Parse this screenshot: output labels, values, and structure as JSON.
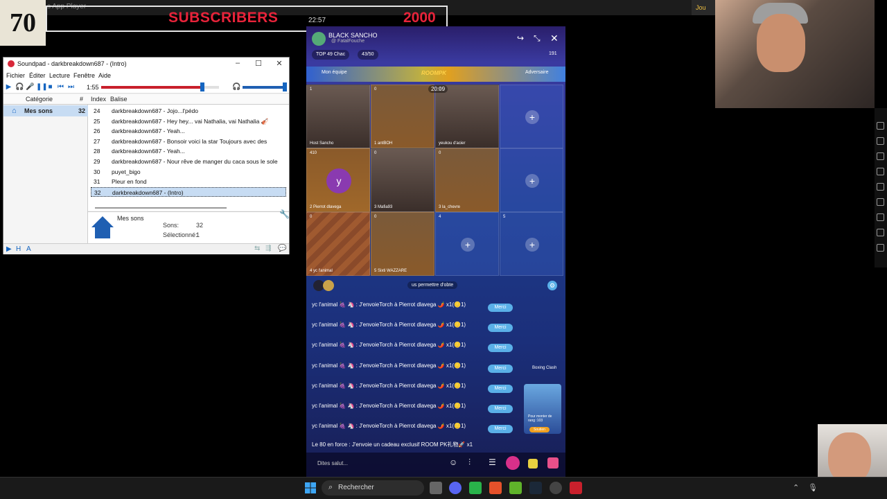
{
  "overlay": {
    "subscriber_count": "70",
    "subscriber_label": "SUBSCRIBERS",
    "subscriber_goal": "2000",
    "clock": "22:57",
    "bluestacks_title": "s App Player",
    "right_top": "Jou"
  },
  "soundpad": {
    "title": "Soundpad - darkbreakdown687 - (Intro)",
    "menu": [
      "Fichier",
      "Éditer",
      "Lecture",
      "Fenêtre",
      "Aide"
    ],
    "time": "1:55",
    "progress": 0.86,
    "volume": 0.95,
    "category_header": "Catégorie",
    "count_header": "#",
    "category": {
      "name": "Mes sons",
      "count": "32"
    },
    "list_header": {
      "index": "Index",
      "tag": "Balise"
    },
    "rows": [
      {
        "index": "24",
        "name": "darkbreakdown687 - Jojo...l'pédo"
      },
      {
        "index": "25",
        "name": "darkbreakdown687 - Hey hey... vai Nathalia, vai Nathalia 🎻"
      },
      {
        "index": "26",
        "name": "darkbreakdown687 - Yeah..."
      },
      {
        "index": "27",
        "name": "darkbreakdown687 - Bonsoir voici la star Toujours avec des"
      },
      {
        "index": "28",
        "name": "darkbreakdown687 - Yeah..."
      },
      {
        "index": "29",
        "name": "darkbreakdown687 - Nour rêve de manger du caca sous le sole"
      },
      {
        "index": "30",
        "name": "puyet_bigo"
      },
      {
        "index": "31",
        "name": "Pleur en fond"
      },
      {
        "index": "32",
        "name": "darkbreakdown687 - (Intro)"
      }
    ],
    "info": {
      "name": "Mes sons",
      "sons_label": "Sons:",
      "sons_value": "32",
      "selected_label": "Sélectionné:",
      "selected_value": "1"
    }
  },
  "phone": {
    "host_name": "BLACK SANCHO",
    "host_sub": "@ FatalFouche",
    "top_badge": "TOP 49 Chac",
    "coins": "43/50",
    "viewers": "191",
    "team_left": "Mon équipe",
    "team_right": "Adversaire",
    "roompk": "ROOMPK",
    "timer": "20:09",
    "cells": [
      {
        "num": "1",
        "name": "Host  Sancho",
        "type": "video"
      },
      {
        "num": "0",
        "name": "1  antBOH",
        "type": "avatar"
      },
      {
        "num": "0",
        "name": "yeukou d'acier",
        "type": "video"
      },
      {
        "num": "",
        "name": "",
        "type": "empty"
      },
      {
        "num": "410",
        "name": "2  Pierrot dlavega",
        "type": "avatar-y"
      },
      {
        "num": "0",
        "name": "3  Mafia93",
        "type": "video"
      },
      {
        "num": "0",
        "name": "3  la_chevre",
        "type": "avatar"
      },
      {
        "num": "",
        "name": "",
        "type": "empty"
      },
      {
        "num": "0",
        "name": "4  yc l'animal",
        "type": "striped"
      },
      {
        "num": "0",
        "name": "5  Sixti WAZZARE",
        "type": "avatar"
      },
      {
        "num": "4",
        "name": "",
        "type": "empty"
      },
      {
        "num": "5",
        "name": "",
        "type": "empty"
      }
    ],
    "notice": "us permettre d'obte",
    "chat": [
      {
        "text": "yc l'animal 🍇 🦄 : J'envoieTorch à Pierrot dlavega 🌶️ x1(🪙1)",
        "button": "Merci"
      },
      {
        "text": "yc l'animal 🍇 🦄 : J'envoieTorch à Pierrot dlavega 🌶️ x1(🪙1)",
        "button": "Merci"
      },
      {
        "text": "yc l'animal 🍇 🦄 : J'envoieTorch à Pierrot dlavega 🌶️ x1(🪙1)",
        "button": "Merci"
      },
      {
        "text": "yc l'animal 🍇 🦄 : J'envoieTorch à Pierrot dlavega 🌶️ x1(🪙1)",
        "button": "Merci"
      },
      {
        "text": "yc l'animal 🍇 🦄 : J'envoieTorch à Pierrot dlavega 🌶️ x1(🪙1)",
        "button": "Merci"
      },
      {
        "text": "yc l'animal 🍇 🦄 : J'envoieTorch à Pierrot dlavega 🌶️ x1(🪙1)",
        "button": "Merci"
      },
      {
        "text": "yc l'animal 🍇 🦄 : J'envoieTorch à Pierrot dlavega 🌶️ x1(🪙1)",
        "button": "Merci"
      }
    ],
    "last_line": "Le 80 en force : J'envoie un cadeau exclusif ROOM PK礼物🚀 x1",
    "input_placeholder": "Dites salut...",
    "boxing": "Boxing Clash",
    "promo_text": "Pour monter de rang :103",
    "promo_button": "Soutien"
  },
  "taskbar": {
    "search": "Rechercher"
  },
  "colors": {
    "subscriber_red": "#e8233a",
    "soundpad_progress": "#c8202c",
    "selection": "#c7dcf3",
    "merci": "#5ab0e8"
  }
}
